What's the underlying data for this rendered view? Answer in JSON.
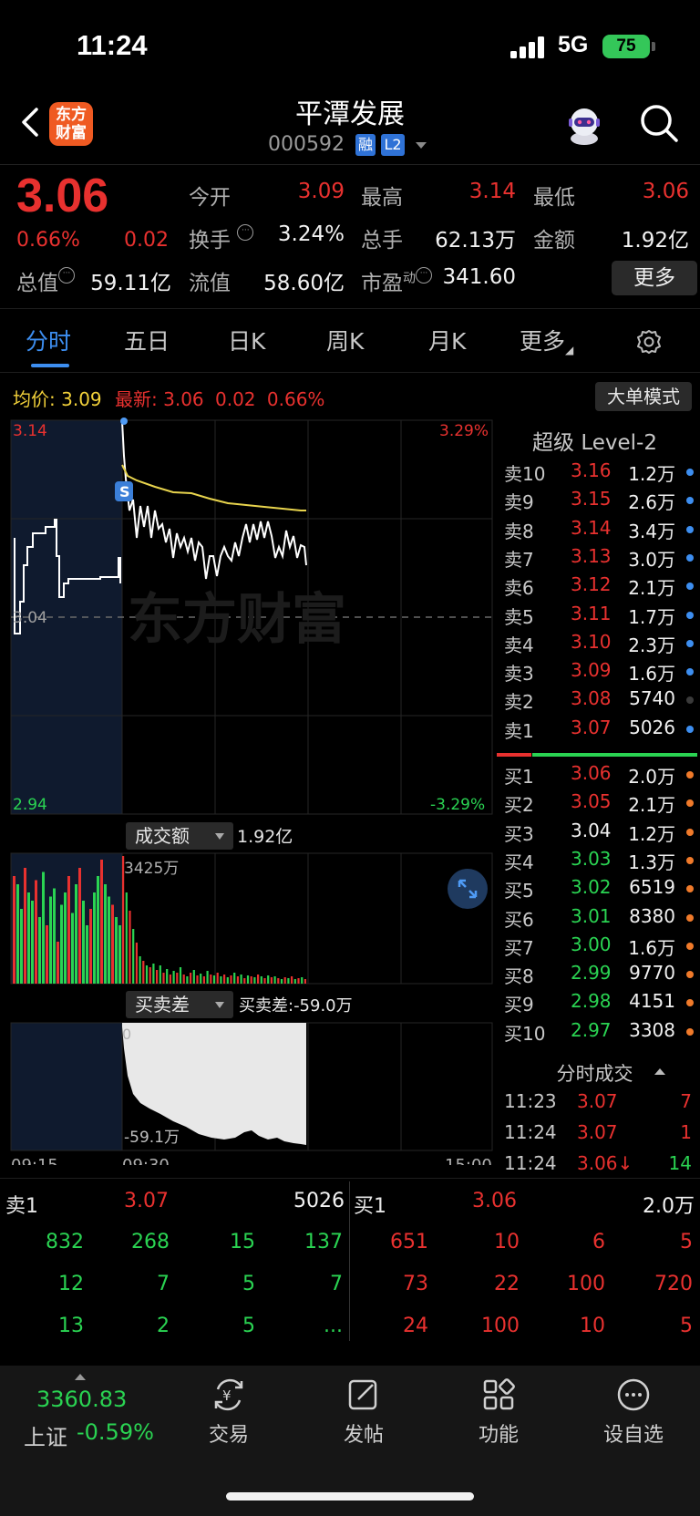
{
  "status_bar": {
    "time": "11:24",
    "network": "5G",
    "battery": "75"
  },
  "header": {
    "logo_text_1": "东方",
    "logo_text_2": "财富",
    "stock_name": "平潭发展",
    "stock_code": "000592",
    "tag_margin": "融",
    "tag_level": "L2"
  },
  "quote": {
    "last_price": "3.06",
    "change_pct": "0.66%",
    "change_amt": "0.02",
    "open_label": "今开",
    "open": "3.09",
    "high_label": "最高",
    "high": "3.14",
    "low_label": "最低",
    "low": "3.06",
    "turnover_label": "换手",
    "turnover": "3.24%",
    "volume_label": "总手",
    "volume": "62.13万",
    "amount_label": "金额",
    "amount": "1.92亿",
    "total_value_label": "总值",
    "total_value": "59.11亿",
    "float_value_label": "流值",
    "float_value": "58.60亿",
    "pe_label": "市盈",
    "pe_sup": "动",
    "pe": "341.60",
    "more_button": "更多"
  },
  "tabs": [
    "分时",
    "五日",
    "日K",
    "周K",
    "月K",
    "更多"
  ],
  "chart_info": {
    "avg_label": "均价:",
    "avg_value": "3.09",
    "latest_label": "最新:",
    "latest_price": "3.06",
    "latest_change": "0.02",
    "latest_pct": "0.66%",
    "big_order_button": "大单模式"
  },
  "chart_data": {
    "type": "line",
    "price_axis": {
      "max": "3.14",
      "mid": "3.04",
      "min": "2.94",
      "max_pct": "3.29%",
      "min_pct": "-3.29%",
      "ylim": [
        2.94,
        3.14
      ]
    },
    "time_labels": [
      "09:15",
      "09:30",
      "15:00"
    ],
    "series": [
      {
        "name": "price",
        "color": "#ffffff"
      },
      {
        "name": "avg",
        "color": "#e8d44d"
      }
    ],
    "auction_marker": "S",
    "volume_panel": {
      "label": "成交额",
      "total": "1.92亿",
      "peak_label": "3425万"
    },
    "diff_panel": {
      "label": "买卖差",
      "readout": "买卖差:-59.0万",
      "top_label": "0",
      "bottom_label": "-59.1万"
    },
    "watermark": "东方财富"
  },
  "level2": {
    "title": "超级 Level-2",
    "asks": [
      {
        "label": "卖10",
        "price": "3.16",
        "vol": "1.2万",
        "dot": "#3d8ef0"
      },
      {
        "label": "卖9",
        "price": "3.15",
        "vol": "2.6万",
        "dot": "#3d8ef0"
      },
      {
        "label": "卖8",
        "price": "3.14",
        "vol": "3.4万",
        "dot": "#3d8ef0"
      },
      {
        "label": "卖7",
        "price": "3.13",
        "vol": "3.0万",
        "dot": "#3d8ef0"
      },
      {
        "label": "卖6",
        "price": "3.12",
        "vol": "2.1万",
        "dot": "#3d8ef0"
      },
      {
        "label": "卖5",
        "price": "3.11",
        "vol": "1.7万",
        "dot": "#3d8ef0"
      },
      {
        "label": "卖4",
        "price": "3.10",
        "vol": "2.3万",
        "dot": "#3d8ef0"
      },
      {
        "label": "卖3",
        "price": "3.09",
        "vol": "1.6万",
        "dot": "#3d8ef0"
      },
      {
        "label": "卖2",
        "price": "3.08",
        "vol": "5740",
        "dot": "#3a3a3a"
      },
      {
        "label": "卖1",
        "price": "3.07",
        "vol": "5026",
        "dot": "#3d8ef0"
      }
    ],
    "bids": [
      {
        "label": "买1",
        "price": "3.06",
        "vol": "2.0万",
        "color": "#e8312f"
      },
      {
        "label": "买2",
        "price": "3.05",
        "vol": "2.1万",
        "color": "#e8312f"
      },
      {
        "label": "买3",
        "price": "3.04",
        "vol": "1.2万",
        "color": "#f0f0f0"
      },
      {
        "label": "买4",
        "price": "3.03",
        "vol": "1.3万",
        "color": "#2ad352"
      },
      {
        "label": "买5",
        "price": "3.02",
        "vol": "6519",
        "color": "#2ad352"
      },
      {
        "label": "买6",
        "price": "3.01",
        "vol": "8380",
        "color": "#2ad352"
      },
      {
        "label": "买7",
        "price": "3.00",
        "vol": "1.6万",
        "color": "#2ad352"
      },
      {
        "label": "买8",
        "price": "2.99",
        "vol": "9770",
        "color": "#2ad352"
      },
      {
        "label": "买9",
        "price": "2.98",
        "vol": "4151",
        "color": "#2ad352"
      },
      {
        "label": "买10",
        "price": "2.97",
        "vol": "3308",
        "color": "#2ad352"
      }
    ],
    "ticks_title": "分时成交",
    "ticks": [
      {
        "time": "11:23",
        "price": "3.07",
        "vol": "7",
        "color": "#e8312f",
        "vol_color": "#e8312f"
      },
      {
        "time": "11:24",
        "price": "3.07",
        "vol": "1",
        "color": "#e8312f",
        "vol_color": "#e8312f"
      },
      {
        "time": "11:24",
        "price": "3.06↓",
        "vol": "14",
        "color": "#e8312f",
        "vol_color": "#2ad352"
      }
    ]
  },
  "queues": {
    "sell_label": "卖1",
    "sell_price": "3.07",
    "sell_vol": "5026",
    "buy_label": "买1",
    "buy_price": "3.06",
    "buy_vol": "2.0万",
    "sell_rows": [
      [
        "832",
        "268",
        "15",
        "137"
      ],
      [
        "12",
        "7",
        "5",
        "7"
      ],
      [
        "13",
        "2",
        "5",
        "..."
      ]
    ],
    "buy_rows": [
      [
        "651",
        "10",
        "6",
        "5"
      ],
      [
        "73",
        "22",
        "100",
        "720"
      ],
      [
        "24",
        "100",
        "10",
        "5"
      ]
    ]
  },
  "bottom_nav": {
    "index_value": "3360.83",
    "index_name": "上证",
    "index_change": "-0.59%",
    "items": [
      "交易",
      "发帖",
      "功能",
      "设自选"
    ]
  }
}
